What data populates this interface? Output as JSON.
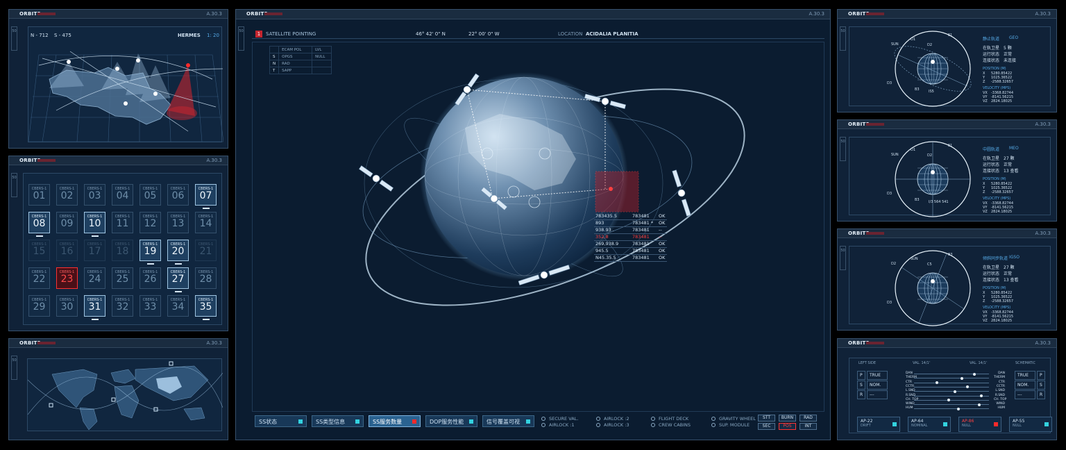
{
  "brand": "ORBITS",
  "panels": {
    "map_code": "A.30.3",
    "grid_code": "A.30.3",
    "world_code": "A.30.3",
    "main_code": "A.30.3",
    "geo_code": "A.30.3",
    "meo_code": "A.30.3",
    "igso_code": "A.30.3",
    "sys_code": "A.30.3",
    "side_num": "50"
  },
  "map_panel": {
    "n": "N - 712",
    "s": "S - 475",
    "hermes": "HERMES",
    "ratio": "1: 20"
  },
  "grid": {
    "tile_label": "CBERS-1",
    "numbers": [
      "01",
      "02",
      "03",
      "04",
      "05",
      "06",
      "07",
      "08",
      "09",
      "10",
      "11",
      "12",
      "13",
      "14",
      "15",
      "16",
      "17",
      "18",
      "19",
      "20",
      "21",
      "22",
      "23",
      "24",
      "25",
      "26",
      "27",
      "28",
      "29",
      "30",
      "31",
      "32",
      "33",
      "34",
      "35"
    ]
  },
  "main": {
    "badge": "1",
    "title": "SATELLITE POINTING",
    "lat": "46° 42' 0\"  N",
    "lon": "22° 00' 0\"  W",
    "location_label": "LOCATION",
    "location": "ACIDALIA PLANITIA",
    "mini_table": {
      "rows": [
        [
          "",
          "ECAM POL",
          "LVL"
        ],
        [
          "S",
          "OPGS",
          "NULL"
        ],
        [
          "N",
          "RAD",
          ""
        ],
        [
          "T",
          "SAPP",
          ""
        ]
      ]
    },
    "readout": [
      [
        "783435.5",
        "783481",
        "OK"
      ],
      [
        "893",
        "783481 *",
        "OK"
      ],
      [
        "938.93 .",
        "783481",
        "--"
      ],
      [
        "352.8",
        "783481",
        "--"
      ],
      [
        "269,938.9",
        "783481",
        "OK"
      ],
      [
        "945.5",
        "783481",
        "OK"
      ],
      [
        "N45.35.5",
        "783481",
        "OK"
      ]
    ],
    "tabs": [
      "SS状态",
      "SS类型信息",
      "SS服务数量",
      "DOP服务性能",
      "信号覆盖可视"
    ],
    "checks": [
      "SECURE VAL.",
      "AIRLOCK :1",
      "AIRLOCK :2",
      "AIRLOCK :3",
      "FLIGHT DECK",
      "CREW CABINS",
      "GRAVITY WHEEL",
      "SUP. MODULE"
    ],
    "modes": [
      "STT",
      "BURN",
      "RAD",
      "SEC",
      "POS",
      "INT"
    ]
  },
  "geo": {
    "title": "静止轨道",
    "type": "GEO",
    "rows": [
      [
        "在轨卫星",
        "5 颗"
      ],
      [
        "运行状态",
        "正常"
      ],
      [
        "连接状态",
        "未连接"
      ]
    ],
    "position": "POSITION (M)",
    "pos_vals": [
      [
        "X",
        "5280.85422"
      ],
      [
        "Y",
        "1025.36522"
      ],
      [
        "Z",
        "-2588.32657"
      ]
    ],
    "velocity": "VELOCITY (MPS)",
    "vel_vals": [
      [
        "VX",
        "-3368.82744"
      ],
      [
        "VY",
        "-8141.56215"
      ],
      [
        "VZ",
        "2824.18025"
      ]
    ],
    "labels": [
      "SUN",
      "D1",
      "D2",
      "E1",
      "D3",
      "B3",
      "IS5"
    ]
  },
  "meo": {
    "title": "中圆轨道",
    "type": "MEO",
    "rows": [
      [
        "在轨卫星",
        "27 颗"
      ],
      [
        "运行状态",
        "正常"
      ],
      [
        "连接状态",
        "13  查看"
      ]
    ],
    "position": "POSITION (M)",
    "pos_vals": [
      [
        "X",
        "5280.85422"
      ],
      [
        "Y",
        "1025.36522"
      ],
      [
        "Z",
        "-2588.32657"
      ]
    ],
    "velocity": "VELOCITY (MPS)",
    "vel_vals": [
      [
        "VX",
        "-3368.82744"
      ],
      [
        "VY",
        "-8141.56215"
      ],
      [
        "VZ",
        "2824.18025"
      ]
    ],
    "labels": [
      "SUN",
      "D1",
      "D2",
      "E1",
      "D3",
      "B3",
      "I/3 564 541"
    ]
  },
  "igso": {
    "title": "倾斜同步轨道",
    "type": "IGSO",
    "rows": [
      [
        "在轨卫星",
        "27 颗"
      ],
      [
        "运行状态",
        "正常"
      ],
      [
        "连接状态",
        "13  查看"
      ]
    ],
    "position": "POSITION (M)",
    "pos_vals": [
      [
        "X",
        "5280.85422"
      ],
      [
        "Y",
        "1025.36522"
      ],
      [
        "Z",
        "-2588.32657"
      ]
    ],
    "velocity": "VELOCITY (MPS)",
    "vel_vals": [
      [
        "VX",
        "-3368.82744"
      ],
      [
        "VY",
        "-8141.56215"
      ],
      [
        "VZ",
        "2824.18025"
      ]
    ],
    "labels": [
      "D2",
      "SUN",
      "C5",
      "B3",
      "D3"
    ]
  },
  "sys": {
    "left_title": "LEFT SIDE",
    "val1": "VAL. 14/1'",
    "val2": "VAL. 14/1'",
    "schematic": "SCHEMATIC",
    "left_rows": [
      [
        "P",
        "TRUE"
      ],
      [
        "S",
        "NOM."
      ],
      [
        "R",
        "---"
      ]
    ],
    "right_rows": [
      [
        "TRUE",
        "P"
      ],
      [
        "NOM.",
        "S"
      ],
      [
        "---",
        "R"
      ]
    ],
    "slider_labels": [
      "DAN",
      "THERM",
      "CTR",
      "CCTR",
      "L.SND",
      "R.SND",
      "CH. TOP",
      "WIND",
      "HUM"
    ],
    "slider_levels": [
      0.82,
      0.64,
      0.3,
      0.72,
      0.55,
      0.91,
      0.46,
      0.88,
      0.6
    ],
    "aps": [
      [
        "AP-22",
        "DRIFT"
      ],
      [
        "AP-64",
        "NOMINAL"
      ],
      [
        "AP-86",
        "NULL"
      ],
      [
        "AP-55",
        "NULL"
      ]
    ]
  },
  "colors": {
    "accent": "#33d2df",
    "alert": "#ff2a2a",
    "panel": "#102238",
    "line": "#9fd0f5"
  }
}
